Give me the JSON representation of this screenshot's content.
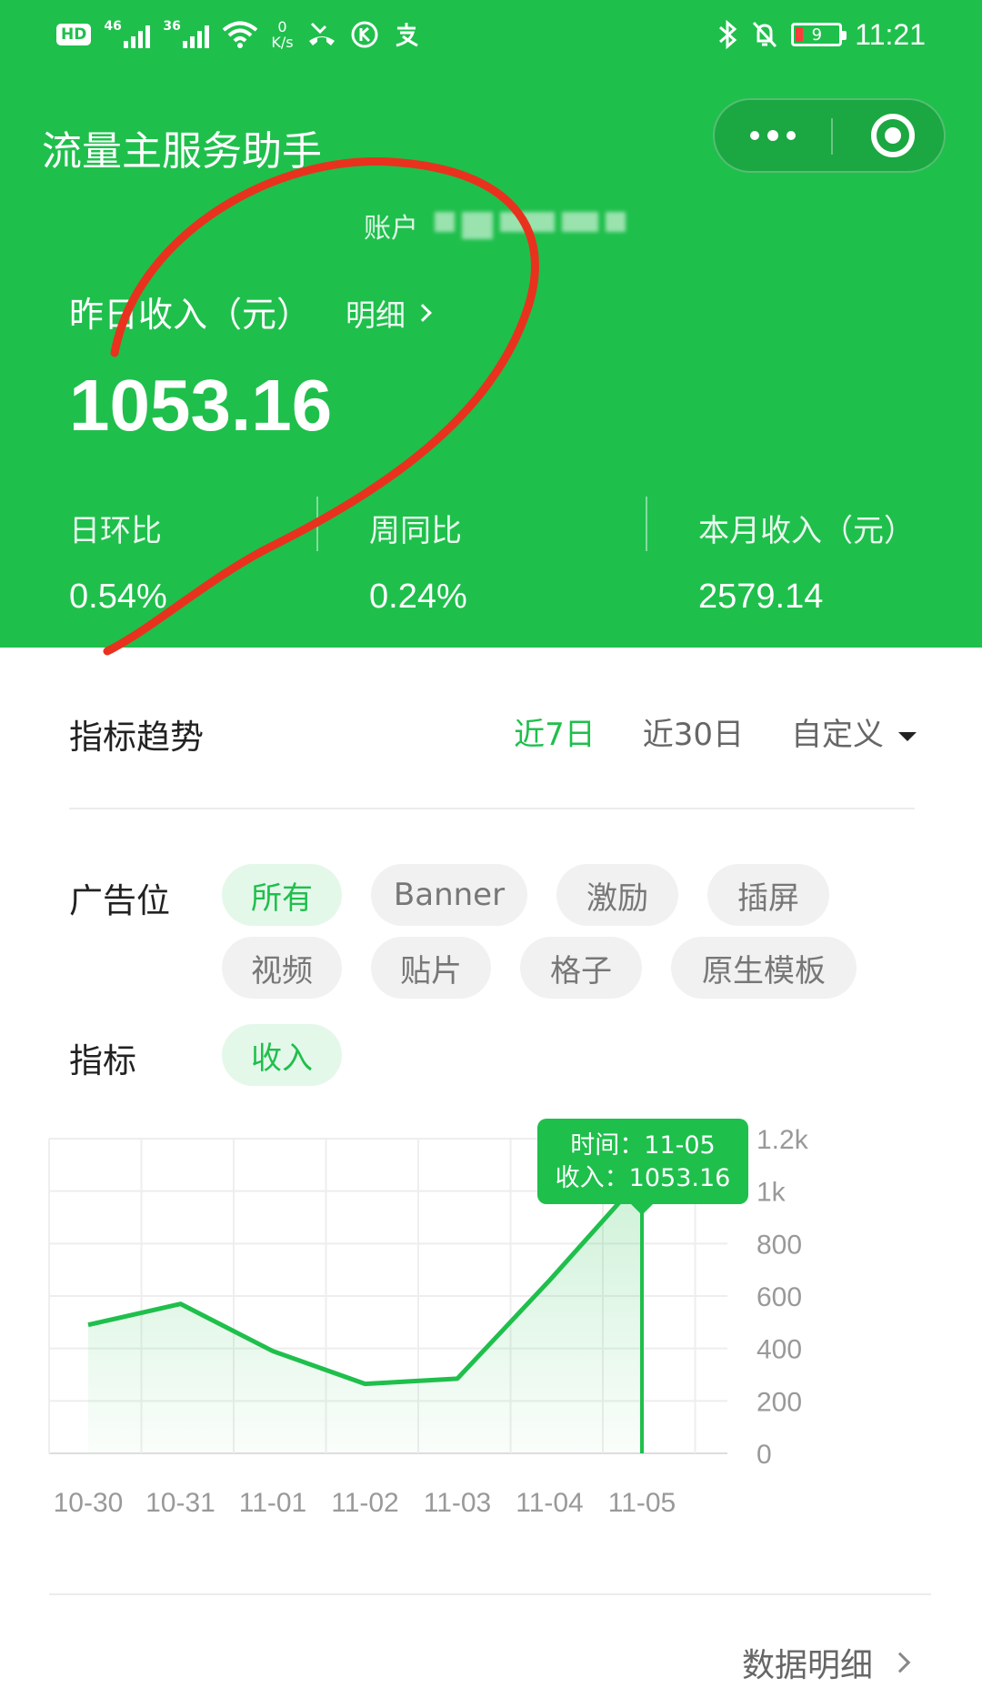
{
  "status_bar": {
    "hd": "HD",
    "net1": "46",
    "net2": "36",
    "speed_value": "0",
    "speed_unit": "K/s",
    "battery": "9",
    "time": "11:21"
  },
  "header": {
    "app_title": "流量主服务助手",
    "account_label": "账户",
    "yesterday_label": "昨日收入（元）",
    "detail_link": "明细",
    "yesterday_value": "1053.16",
    "kpis": [
      {
        "label": "日环比",
        "value": "0.54%"
      },
      {
        "label": "周同比",
        "value": "0.24%"
      },
      {
        "label": "本月收入（元）",
        "value": "2579.14"
      }
    ]
  },
  "trend": {
    "title": "指标趋势",
    "tabs": [
      {
        "label": "近7日",
        "active": true
      },
      {
        "label": "近30日",
        "active": false
      },
      {
        "label": "自定义",
        "active": false
      }
    ]
  },
  "filters": {
    "ad_slot_label": "广告位",
    "ad_slots": [
      {
        "label": "所有",
        "active": true
      },
      {
        "label": "Banner",
        "active": false
      },
      {
        "label": "激励",
        "active": false
      },
      {
        "label": "插屏",
        "active": false
      },
      {
        "label": "视频",
        "active": false
      },
      {
        "label": "贴片",
        "active": false
      },
      {
        "label": "格子",
        "active": false
      },
      {
        "label": "原生模板",
        "active": false
      }
    ],
    "metric_label": "指标",
    "metrics": [
      {
        "label": "收入",
        "active": true
      }
    ]
  },
  "chart_data": {
    "type": "area",
    "categories": [
      "10-30",
      "10-31",
      "11-01",
      "11-02",
      "11-03",
      "11-04",
      "11-05"
    ],
    "series": [
      {
        "values": [
          490,
          570,
          390,
          265,
          285,
          660,
          1053.16
        ]
      }
    ],
    "y_ticks": [
      "0",
      "200",
      "400",
      "600",
      "800",
      "1k",
      "1.2k"
    ],
    "ylim": [
      0,
      1200
    ],
    "grid": true,
    "tooltip": {
      "line1": "时间：11-05",
      "line2": "收入：1053.16",
      "index": 6
    },
    "colors": {
      "line": "#1fbf4c",
      "grid": "#eeeeee",
      "axis_text": "#999999",
      "tooltip_bg": "#1fbf4c"
    }
  },
  "footer": {
    "data_detail_link": "数据明细"
  },
  "colors": {
    "brand": "#1fbf4c",
    "annotation": "#e8321e"
  }
}
